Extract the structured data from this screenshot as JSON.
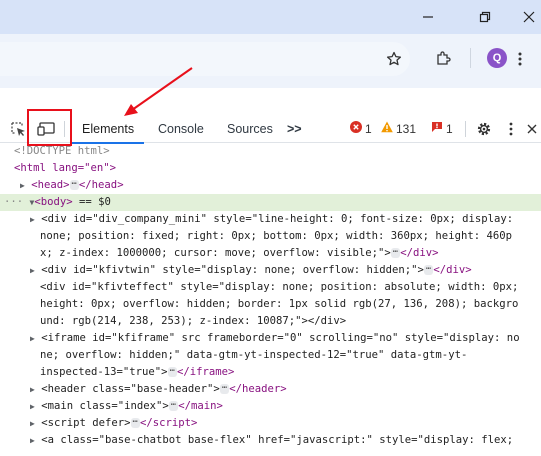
{
  "browser": {
    "profile_initial": "Q"
  },
  "devtools": {
    "tabs": [
      "Elements",
      "Console",
      "Sources"
    ],
    "more_tabs": ">>",
    "errors": "1",
    "warnings": "131",
    "issues": "1"
  },
  "dom": {
    "doctype": "<!DOCTYPE html>",
    "html_open": "<html lang=\"en\">",
    "head": "<head>",
    "head_close": "</head>",
    "body_marker": "== $0",
    "lines": [
      "<div id=\"div_company_mini\" style=\"line-height: 0; font-size: 0px; display:",
      "none; position: fixed; right: 0px; bottom: 0px; width: 360px; height: 460p",
      "x; z-index: 1000000; cursor: move; overflow: visible;\">",
      "<div id=\"kfivtwin\" style=\"display: none; overflow: hidden;\">",
      "<div id=\"kfivteffect\" style=\"display: none; position: absolute; width: 0px;",
      "height: 0px; overflow: hidden; border: 1px solid rgb(27, 136, 208); backgro",
      "und: rgb(214, 238, 253); z-index: 10087;\"></div>",
      "<iframe id=\"kfiframe\" src frameborder=\"0\" scrolling=\"no\" style=\"display: no",
      "ne; overflow: hidden;\" data-gtm-yt-inspected-12=\"true\" data-gtm-yt-",
      "inspected-13=\"true\">",
      "<header class=\"base-header\">",
      "<main class=\"index\">",
      "<script defer>",
      "<a class=\"base-chatbot base-flex\" href=\"javascript:\" style=\"display: flex;"
    ]
  },
  "colors": {
    "accent": "#1a73e8",
    "annotation_red": "#e8101b"
  }
}
